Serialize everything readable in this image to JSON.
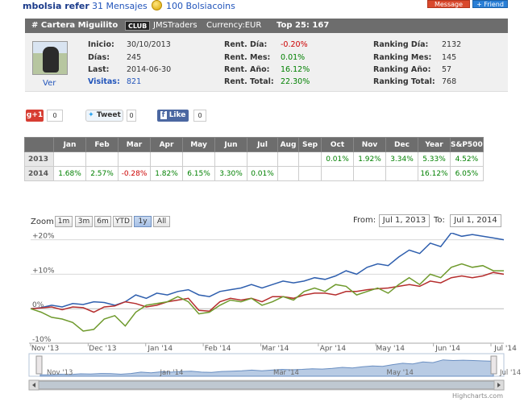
{
  "header": {
    "username": "mbolsia refer",
    "messages": "31 Mensajes",
    "bolsiacoins": "100 Bolsiacoins",
    "message_button": "Message",
    "friend_button": "+ Friend"
  },
  "portfolio": {
    "name": "# Cartera Miguilito",
    "club_badge": "CLUB",
    "group": "JMSTraders",
    "currency": "Currency:EUR",
    "top": "Top 25: 167",
    "avatar_link": "Ver",
    "info": [
      {
        "label": "Inicio:",
        "value": "30/10/2013"
      },
      {
        "label": "Días:",
        "value": "245"
      },
      {
        "label": "Last:",
        "value": "2014-06-30"
      },
      {
        "label": "Visitas:",
        "value": "821"
      }
    ],
    "returns": [
      {
        "label": "Rent. Día:",
        "value": "-0.20%"
      },
      {
        "label": "Rent. Mes:",
        "value": "0.01%"
      },
      {
        "label": "Rent. Año:",
        "value": "16.12%"
      },
      {
        "label": "Rent. Total:",
        "value": "22.30%"
      }
    ],
    "rankings": [
      {
        "label": "Ranking Día:",
        "value": "2132"
      },
      {
        "label": "Ranking Mes:",
        "value": "145"
      },
      {
        "label": "Ranking Año:",
        "value": "57"
      },
      {
        "label": "Ranking Total:",
        "value": "768"
      }
    ]
  },
  "social": {
    "gplus_label": "g+1",
    "gplus_count": "0",
    "tweet_label": "Tweet",
    "tweet_count": "0",
    "like_label": "Like",
    "like_count": "0"
  },
  "monthly_table": {
    "headers": [
      "",
      "Jan",
      "Feb",
      "Mar",
      "Apr",
      "May",
      "Jun",
      "Jul",
      "Aug",
      "Sep",
      "Oct",
      "Nov",
      "Dec",
      "Year",
      "S&P500"
    ],
    "rows": [
      {
        "year": "2013",
        "cells": [
          "",
          "",
          "",
          "",
          "",
          "",
          "",
          "",
          "",
          "0.01%",
          "1.92%",
          "3.34%",
          "5.33%",
          "4.52%"
        ]
      },
      {
        "year": "2014",
        "cells": [
          "1.68%",
          "2.57%",
          "-0.28%",
          "1.82%",
          "6.15%",
          "3.30%",
          "0.01%",
          "",
          "",
          "",
          "",
          "",
          "16.12%",
          "6.05%"
        ]
      }
    ]
  },
  "chart_toolbar": {
    "zoom_label": "Zoom",
    "buttons": [
      "1m",
      "3m",
      "6m",
      "YTD",
      "1y",
      "All"
    ],
    "active_button": "1y",
    "from_label": "From:",
    "from_value": "Jul 1, 2013",
    "to_label": "To:",
    "to_value": "Jul 1, 2014"
  },
  "chart_data": {
    "type": "line",
    "yticks": [
      "+20%",
      "+10%",
      "0%",
      "-10%"
    ],
    "ytick_values": [
      20,
      10,
      0,
      -10
    ],
    "ylim": [
      -10,
      22
    ],
    "xticks": [
      "Nov '13",
      "Dec '13",
      "Jan '14",
      "Feb '14",
      "Mar '14",
      "Apr '14",
      "May '14",
      "Jun '14",
      "Jul '14"
    ],
    "navigator_ticks": [
      "Nov '13",
      "Jan '14",
      "Mar '14",
      "May '14",
      "Jul '14"
    ],
    "credit": "Highcharts.com",
    "series": [
      {
        "color": "#2f5fae",
        "values": [
          0,
          0.3,
          1,
          0.5,
          1.5,
          1.2,
          2,
          1.8,
          1,
          2,
          4,
          3,
          4.5,
          4,
          5,
          5.5,
          4,
          3.5,
          5,
          5.5,
          6,
          7,
          6,
          7,
          8,
          7.5,
          8,
          9,
          8.5,
          9.5,
          11,
          10,
          12,
          13,
          12.5,
          15,
          17,
          16,
          19,
          18,
          22,
          21,
          21.5,
          21,
          20.5,
          20
        ]
      },
      {
        "color": "#b52d2d",
        "values": [
          0,
          0.2,
          0.5,
          -0.3,
          0.5,
          0.3,
          -1,
          0.5,
          0.8,
          2,
          1.5,
          0.5,
          1,
          2,
          2.5,
          3,
          -0.5,
          -0.7,
          2,
          3,
          2.5,
          3,
          2,
          3.5,
          3.5,
          3,
          4,
          4.5,
          4.5,
          4,
          5,
          5,
          5.5,
          5.8,
          6,
          6.5,
          7,
          6.5,
          8,
          7.5,
          9,
          9.5,
          9,
          9.5,
          10.5,
          10
        ]
      },
      {
        "color": "#6f9a2d",
        "values": [
          0,
          -1,
          -2.5,
          -3,
          -4,
          -6.5,
          -6,
          -3,
          -2,
          -5,
          -1,
          1,
          1.5,
          2,
          3.5,
          2,
          -1.5,
          -1,
          1,
          2.5,
          2,
          3,
          1,
          2,
          3.5,
          2.5,
          5,
          6,
          5,
          7,
          6.5,
          4,
          5,
          6,
          4.5,
          7,
          9,
          7,
          10,
          9,
          12,
          13,
          12,
          12.5,
          11,
          11
        ]
      }
    ],
    "navigator_values": [
      0,
      0.3,
      1,
      0.5,
      1.5,
      1.2,
      2,
      1.8,
      1,
      2,
      4,
      3,
      4.5,
      4,
      5,
      5.5,
      4,
      3.5,
      5,
      5.5,
      6,
      7,
      6,
      7,
      8,
      7.5,
      8,
      9,
      8.5,
      9.5,
      11,
      10,
      12,
      13,
      12.5,
      15,
      17,
      16,
      19,
      18,
      22,
      21,
      21.5,
      21,
      20.5,
      20
    ]
  }
}
